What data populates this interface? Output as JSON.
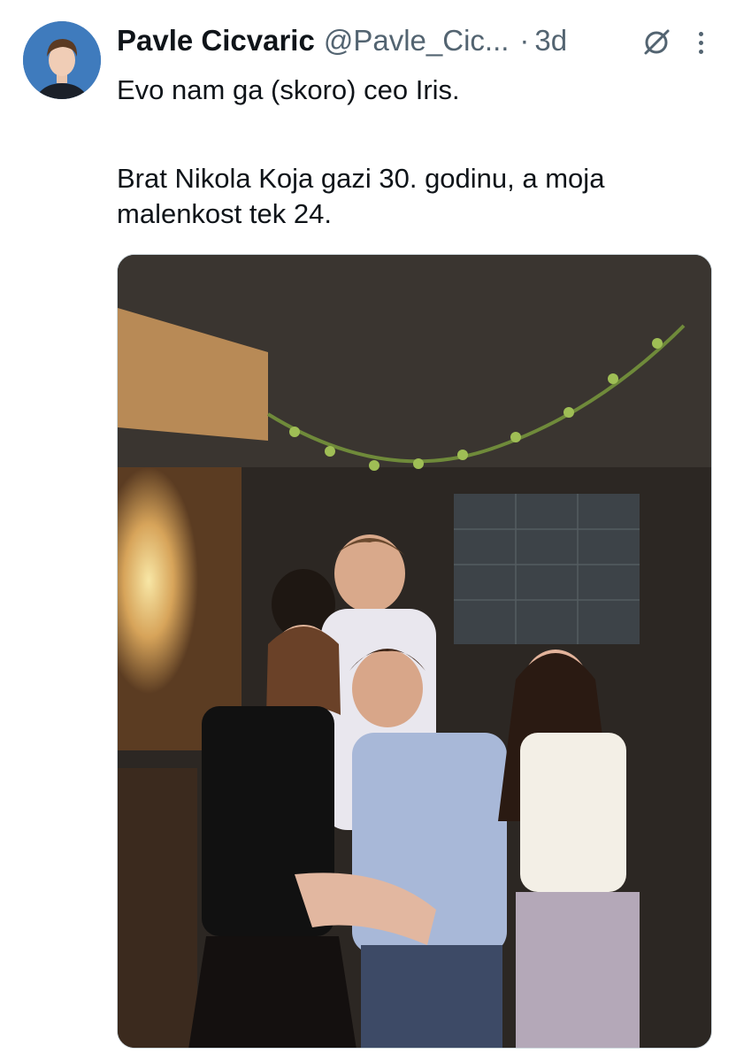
{
  "tweet": {
    "author_name": "Pavle Cicvaric",
    "author_handle": "@Pavle_Cic...",
    "separator": "·",
    "time": "3d",
    "line1": "Evo nam ga (skoro) ceo Iris.",
    "line2": "Brat Nikola Koja gazi 30. godinu, a moja malenkost tek 24.",
    "icons": {
      "grok": "grok-icon",
      "more": "more-options-icon"
    },
    "colors": {
      "text": "#0f1419",
      "secondary": "#536471"
    }
  }
}
